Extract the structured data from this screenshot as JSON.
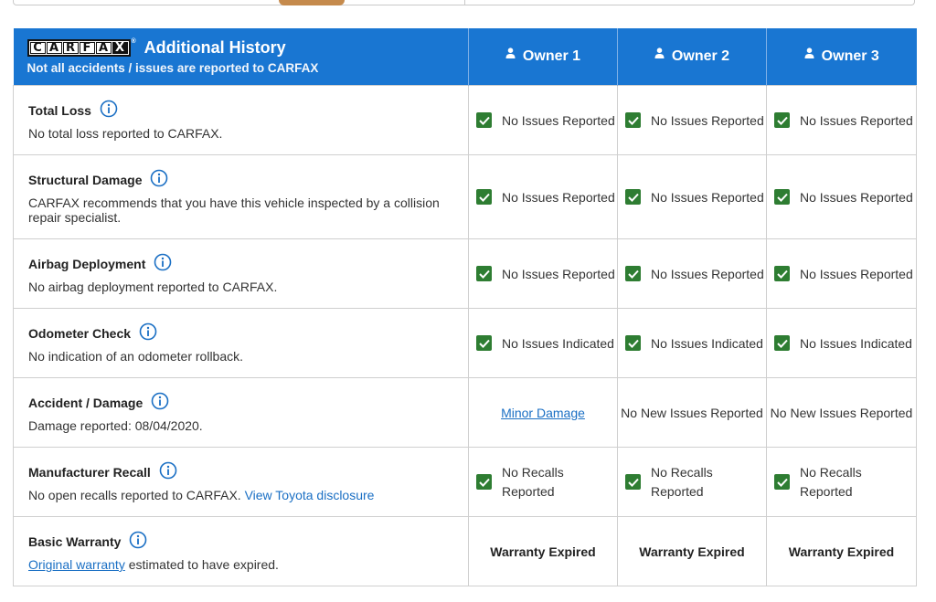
{
  "header": {
    "logo_letters": [
      "C",
      "A",
      "R",
      "F",
      "A",
      "X"
    ],
    "title": "Additional History",
    "subtitle": "Not all accidents / issues are reported to CARFAX",
    "owners": [
      "Owner 1",
      "Owner 2",
      "Owner 3"
    ]
  },
  "rows": {
    "total_loss": {
      "title": "Total Loss",
      "desc": "No total loss reported to CARFAX.",
      "statuses": [
        "No Issues Reported",
        "No Issues Reported",
        "No Issues Reported"
      ]
    },
    "structural_damage": {
      "title": "Structural Damage",
      "desc": "CARFAX recommends that you have this vehicle inspected by a collision repair specialist.",
      "statuses": [
        "No Issues Reported",
        "No Issues Reported",
        "No Issues Reported"
      ]
    },
    "airbag": {
      "title": "Airbag Deployment",
      "desc": "No airbag deployment reported to CARFAX.",
      "statuses": [
        "No Issues Reported",
        "No Issues Reported",
        "No Issues Reported"
      ]
    },
    "odometer": {
      "title": "Odometer Check",
      "desc": "No indication of an odometer rollback.",
      "statuses": [
        "No Issues Indicated",
        "No Issues Indicated",
        "No Issues Indicated"
      ]
    },
    "accident": {
      "title": "Accident / Damage",
      "desc": "Damage reported: 08/04/2020.",
      "owner1_link": "Minor Damage",
      "statuses": [
        "No New Issues Reported",
        "No New Issues Reported"
      ]
    },
    "recall": {
      "title": "Manufacturer Recall",
      "desc": "No open recalls reported to CARFAX.",
      "link": "View Toyota disclosure",
      "statuses": [
        "No Recalls Reported",
        "No Recalls Reported",
        "No Recalls Reported"
      ]
    },
    "warranty": {
      "title": "Basic Warranty",
      "link": "Original warranty",
      "desc": "estimated to have expired.",
      "statuses": [
        "Warranty Expired",
        "Warranty Expired",
        "Warranty Expired"
      ]
    }
  },
  "icons": {
    "check": "checkbox-checked-icon",
    "info": "info-circle-icon",
    "owner": "person-icon"
  },
  "colors": {
    "header_blue": "#1976d2",
    "check_green": "#2e7d32",
    "link_blue": "#1a6fc4"
  }
}
